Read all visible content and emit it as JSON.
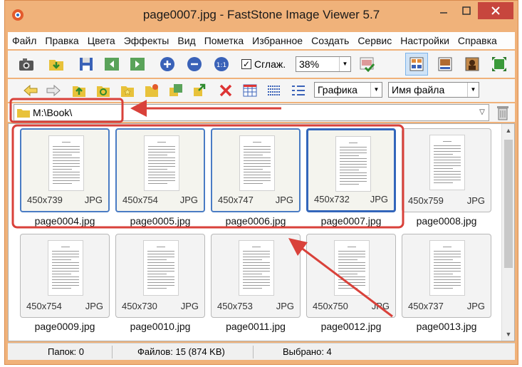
{
  "window": {
    "title": "page0007.jpg  -  FastStone Image Viewer 5.7"
  },
  "menu": [
    "Файл",
    "Правка",
    "Цвета",
    "Эффекты",
    "Вид",
    "Пометка",
    "Избранное",
    "Создать",
    "Сервис",
    "Настройки",
    "Справка"
  ],
  "toolbar": {
    "smooth_label": "Сглаж.",
    "smooth_checked": "✓",
    "zoom_value": "38%",
    "filter_value": "Графика",
    "sort_value": "Имя файла"
  },
  "path": {
    "value": "M:\\Book\\"
  },
  "thumbnails": [
    {
      "name": "page0004.jpg",
      "dims": "450x739",
      "format": "JPG"
    },
    {
      "name": "page0005.jpg",
      "dims": "450x754",
      "format": "JPG"
    },
    {
      "name": "page0006.jpg",
      "dims": "450x747",
      "format": "JPG"
    },
    {
      "name": "page0007.jpg",
      "dims": "450x732",
      "format": "JPG"
    },
    {
      "name": "page0008.jpg",
      "dims": "450x759",
      "format": "JPG"
    },
    {
      "name": "page0009.jpg",
      "dims": "450x754",
      "format": "JPG"
    },
    {
      "name": "page0010.jpg",
      "dims": "450x730",
      "format": "JPG"
    },
    {
      "name": "page0011.jpg",
      "dims": "450x753",
      "format": "JPG"
    },
    {
      "name": "page0012.jpg",
      "dims": "450x750",
      "format": "JPG"
    },
    {
      "name": "page0013.jpg",
      "dims": "450x737",
      "format": "JPG"
    }
  ],
  "status": {
    "folders": "Папок: 0",
    "files": "Файлов: 15 (874 KB)",
    "selected": "Выбрано: 4"
  },
  "colors": {
    "annotation": "#d9413a",
    "selection": "#3366bb",
    "titlebar": "#f0b27a"
  }
}
